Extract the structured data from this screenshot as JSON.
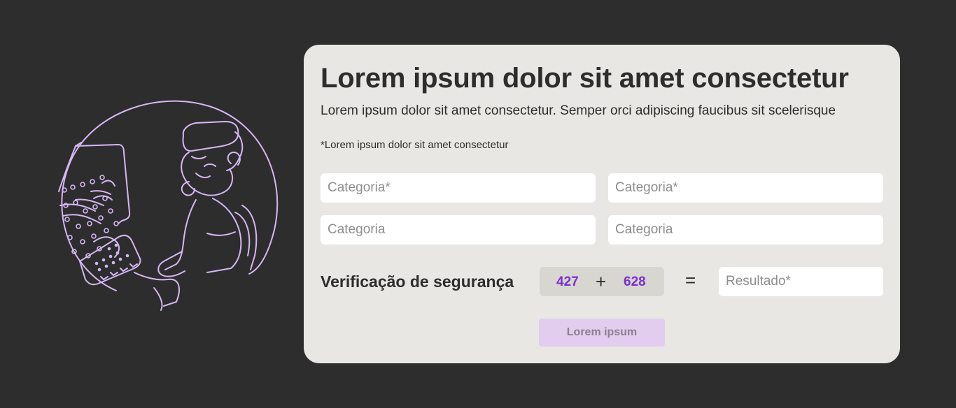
{
  "form": {
    "title": "Lorem ipsum dolor sit amet consectetur",
    "subtitle": "Lorem ipsum dolor sit amet consectetur. Semper orci adipiscing faucibus sit scelerisque",
    "note": "*Lorem ipsum dolor sit amet consectetur",
    "fields": [
      {
        "placeholder": "Categoria*",
        "value": ""
      },
      {
        "placeholder": "Categoria*",
        "value": ""
      },
      {
        "placeholder": "Categoria",
        "value": ""
      },
      {
        "placeholder": "Categoria",
        "value": ""
      }
    ],
    "verification": {
      "label": "Verificação de segurança",
      "number_a": "427",
      "operator": "+",
      "number_b": "628",
      "equals": "=",
      "result_placeholder": "Resultado*"
    },
    "submit_label": "Lorem ipsum"
  },
  "colors": {
    "background": "#2d2d2d",
    "card": "#e8e7e3",
    "accent": "#7b2fd1",
    "illustration_stroke": "#d7b6f5",
    "button_bg": "#e2cdee"
  },
  "illustration": {
    "icon": "person-at-computer-illustration"
  }
}
